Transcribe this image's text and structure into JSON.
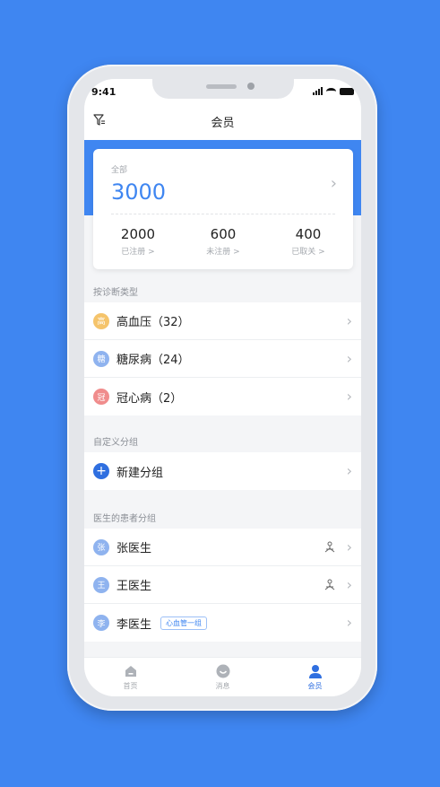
{
  "status_bar": {
    "time": "9:41"
  },
  "header": {
    "title": "会员"
  },
  "summary": {
    "total_label": "全部",
    "total_value": "3000",
    "stats": [
      {
        "value": "2000",
        "label": "已注册 >"
      },
      {
        "value": "600",
        "label": "未注册 >"
      },
      {
        "value": "400",
        "label": "已取关 >"
      }
    ]
  },
  "diagnosis_section": {
    "title": "按诊断类型",
    "items": [
      {
        "avatar": "高",
        "label": "高血压（32）",
        "color": "#f5c46b"
      },
      {
        "avatar": "糖",
        "label": "糖尿病（24）",
        "color": "#8fb3ef"
      },
      {
        "avatar": "冠",
        "label": "冠心病（2）",
        "color": "#f08c8c"
      }
    ]
  },
  "custom_section": {
    "title": "自定义分组",
    "new_group_label": "新建分组"
  },
  "doctor_section": {
    "title": "医生的患者分组",
    "items": [
      {
        "avatar": "张",
        "label": "张医生",
        "color": "#8fb3ef"
      },
      {
        "avatar": "王",
        "label": "王医生",
        "color": "#8fb3ef"
      },
      {
        "avatar": "李",
        "label": "李医生",
        "color": "#8fb3ef",
        "tag": "心血管一组"
      }
    ]
  },
  "tabbar": {
    "tabs": [
      {
        "label": "首页",
        "icon": "home-icon"
      },
      {
        "label": "消息",
        "icon": "message-icon"
      },
      {
        "label": "会员",
        "icon": "member-icon"
      }
    ]
  },
  "colors": {
    "accent": "#3f86f1",
    "background": "#f4f5f7"
  }
}
